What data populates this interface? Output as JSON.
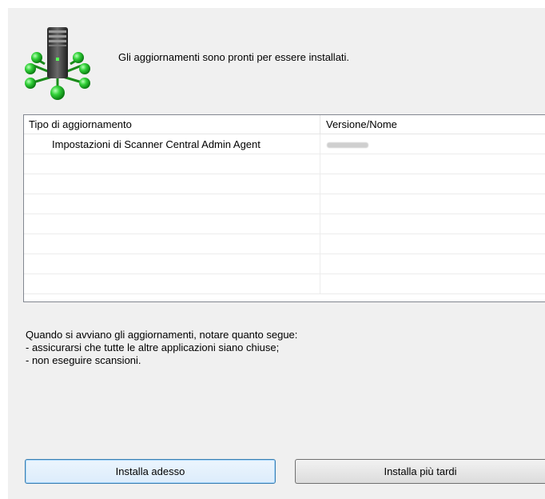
{
  "header": {
    "icon": "network-server-icon",
    "message": "Gli aggiornamenti sono pronti per essere installati."
  },
  "updates_table": {
    "columns": [
      "Tipo di aggiornamento",
      "Versione/Nome"
    ],
    "rows": [
      {
        "type": "Impostazioni di Scanner Central Admin Agent",
        "version": ""
      }
    ],
    "empty_rows": 7
  },
  "notes": {
    "line1": "Quando si avviano gli aggiornamenti, notare quanto segue:",
    "line2": "- assicurarsi che tutte le altre applicazioni siano chiuse;",
    "line3": "- non eseguire scansioni."
  },
  "buttons": {
    "install_now": "Installa adesso",
    "install_later": "Installa più tardi"
  },
  "colors": {
    "dialog_bg": "#f0f0f0",
    "node_green": "#22c02a",
    "primary_border": "#3c7fb1"
  }
}
